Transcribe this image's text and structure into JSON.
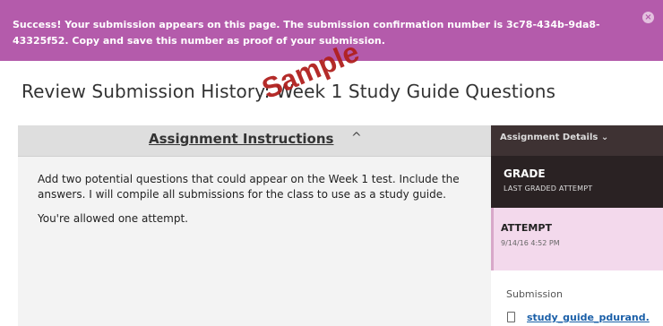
{
  "banner": {
    "message": "Success! Your submission appears on this page. The submission confirmation number is 3c78-434b-9da8-43325f52. Copy and save this number as proof of your submission.",
    "close_symbol": "×"
  },
  "page_title": "Review Submission History: Week 1 Study Guide Questions",
  "watermark": "Sample",
  "instructions": {
    "header_label": "Assignment Instructions",
    "chevron": "^",
    "paragraphs": [
      "Add two potential questions that could appear on the Week 1 test. Include the answers. I will compile all submissions for the class to use as a study guide.",
      "You're allowed one attempt."
    ]
  },
  "details": {
    "header_label": "Assignment Details",
    "header_chevron": "⌄",
    "grade_title": "GRADE",
    "grade_subtitle": "LAST GRADED ATTEMPT",
    "attempt_title": "ATTEMPT",
    "attempt_date": "9/14/16 4:52 PM",
    "submission_label": "Submission",
    "file_name": "study_guide_pdurand."
  },
  "colors": {
    "banner": "#b45bab",
    "details_header": "#3e3233",
    "grade_bg": "#2a2223",
    "attempt_bg": "#f3d9ec",
    "watermark": "#b0201e",
    "link": "#1a5fa8"
  }
}
